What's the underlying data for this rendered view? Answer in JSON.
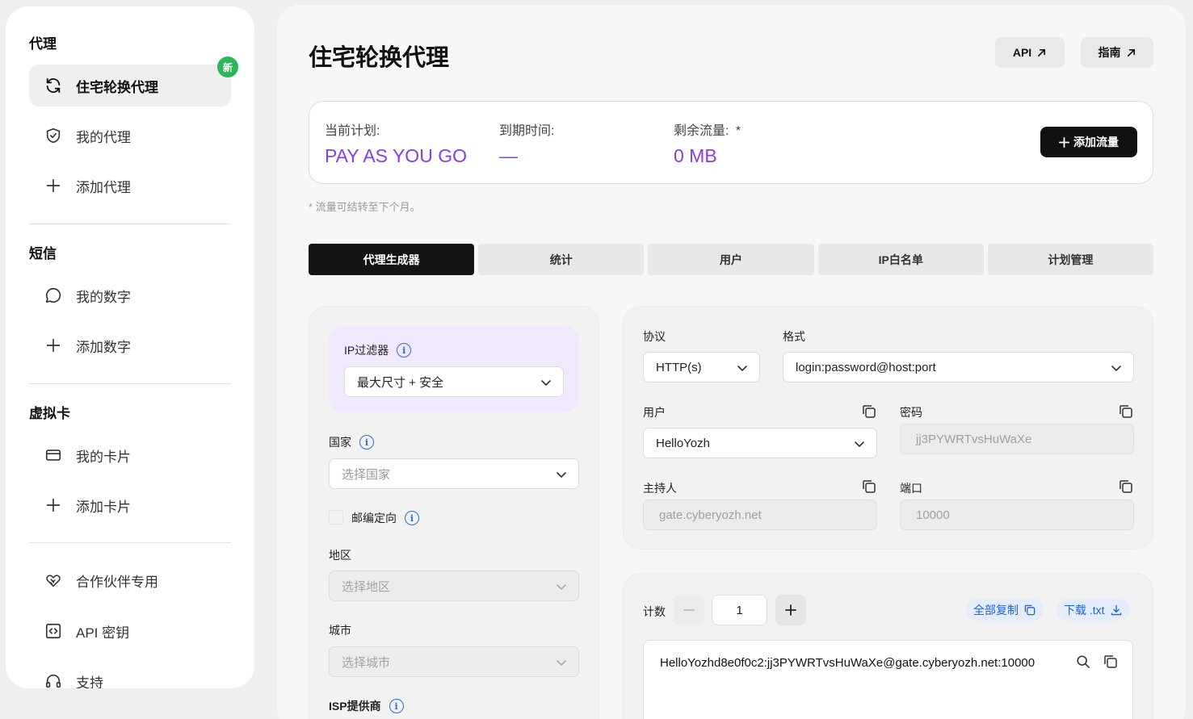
{
  "sidebar": {
    "sections": [
      {
        "title": "代理",
        "items": [
          {
            "label": "住宅轮换代理",
            "icon": "refresh-icon",
            "active": true,
            "badge": "新"
          },
          {
            "label": "我的代理",
            "icon": "shield-check-icon"
          },
          {
            "label": "添加代理",
            "icon": "plus-icon"
          }
        ]
      },
      {
        "title": "短信",
        "items": [
          {
            "label": "我的数字",
            "icon": "chat-bubble-icon"
          },
          {
            "label": "添加数字",
            "icon": "plus-icon"
          }
        ]
      },
      {
        "title": "虚拟卡",
        "items": [
          {
            "label": "我的卡片",
            "icon": "credit-card-icon"
          },
          {
            "label": "添加卡片",
            "icon": "plus-icon"
          }
        ]
      }
    ],
    "extra_items": [
      {
        "label": "合作伙伴专用",
        "icon": "handshake-icon"
      },
      {
        "label": "API 密钥",
        "icon": "code-icon"
      },
      {
        "label": "支持",
        "icon": "headset-icon"
      }
    ]
  },
  "header": {
    "title": "住宅轮换代理",
    "api_label": "API",
    "guide_label": "指南"
  },
  "plan": {
    "current_label": "当前计划:",
    "current_value": "PAY AS YOU GO",
    "expiry_label": "到期时间:",
    "expiry_value": "—",
    "traffic_label": "剩余流量:",
    "traffic_asterisk": "*",
    "traffic_value": "0 MB",
    "add_traffic_label": "添加流量",
    "note": "* 流量可结转至下个月。",
    "accent_color": "#8a3ce8"
  },
  "tabs": [
    "代理生成器",
    "统计",
    "用户",
    "IP白名单",
    "计划管理"
  ],
  "filters": {
    "ip_filter_label": "IP过滤器",
    "ip_filter_value": "最大尺寸 + 安全",
    "country_label": "国家",
    "country_placeholder": "选择国家",
    "zip_label": "邮编定向",
    "region_label": "地区",
    "region_placeholder": "选择地区",
    "city_label": "城市",
    "city_placeholder": "选择城市",
    "isp_label": "ISP提供商"
  },
  "connection": {
    "protocol_label": "协议",
    "protocol_value": "HTTP(s)",
    "format_label": "格式",
    "format_value": "login:password@host:port",
    "user_label": "用户",
    "user_value": "HelloYozh",
    "password_label": "密码",
    "password_value": "jj3PYWRTvsHuWaXe",
    "host_label": "主持人",
    "host_value": "gate.cyberyozh.net",
    "port_label": "端口",
    "port_value": "10000"
  },
  "output": {
    "count_label": "计数",
    "count_value": "1",
    "copy_all_label": "全部复制",
    "download_label": "下载 .txt",
    "proxy_line": "HelloYozhd8e0f0c2:jj3PYWRTvsHuWaXe@gate.cyberyozh.net:10000"
  }
}
